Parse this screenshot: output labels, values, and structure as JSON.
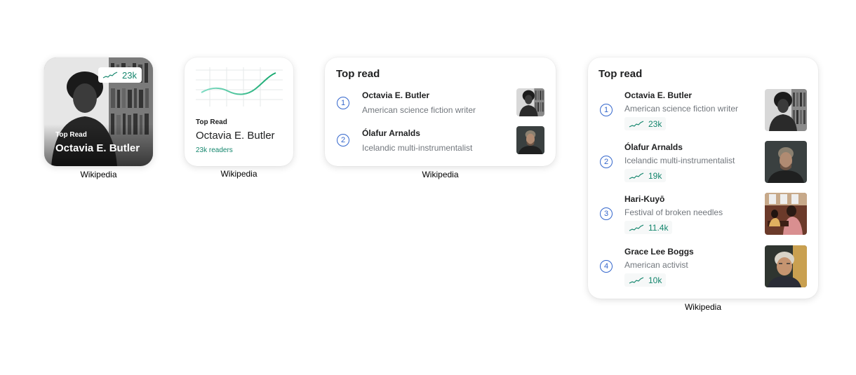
{
  "accent_color": "#14866d",
  "rank_color": "#3366cc",
  "small_photo": {
    "views": "23k",
    "top_label": "Top Read",
    "name": "Octavia E. Butler",
    "caption": "Wikipedia"
  },
  "small_chart": {
    "top_label": "Top Read",
    "name": "Octavia E. Butler",
    "readers": "23k readers",
    "caption": "Wikipedia"
  },
  "medium": {
    "title": "Top read",
    "caption": "Wikipedia",
    "items": [
      {
        "rank": "1",
        "name": "Octavia E. Butler",
        "description": "American science fiction writer"
      },
      {
        "rank": "2",
        "name": "Ólafur Arnalds",
        "description": "Icelandic multi-instrumentalist"
      }
    ]
  },
  "large": {
    "title": "Top read",
    "caption": "Wikipedia",
    "items": [
      {
        "rank": "1",
        "name": "Octavia E. Butler",
        "description": "American science fiction writer",
        "views": "23k"
      },
      {
        "rank": "2",
        "name": "Ólafur Arnalds",
        "description": "Icelandic multi-instrumentalist",
        "views": "19k"
      },
      {
        "rank": "3",
        "name": "Hari-Kuyō",
        "description": "Festival of broken needles",
        "views": "11.4k"
      },
      {
        "rank": "4",
        "name": "Grace Lee Boggs",
        "description": "American activist",
        "views": "10k"
      }
    ]
  }
}
